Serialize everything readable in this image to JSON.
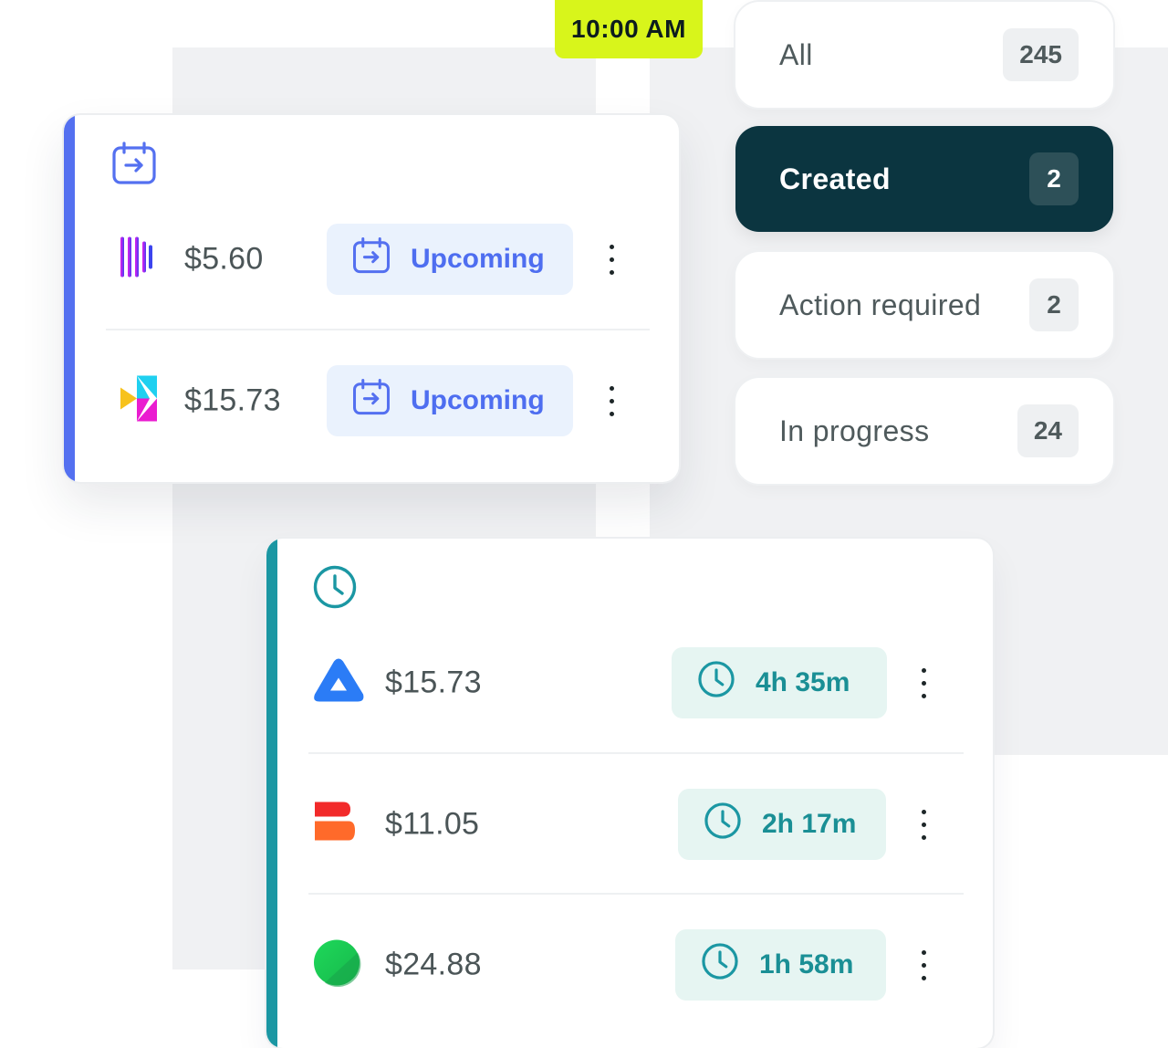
{
  "time_badge": "10:00 AM",
  "filters": [
    {
      "label": "All",
      "count": "245",
      "active": false
    },
    {
      "label": "Created",
      "count": "2",
      "active": true
    },
    {
      "label": "Action required",
      "count": "2",
      "active": false
    },
    {
      "label": "In progress",
      "count": "24",
      "active": false
    }
  ],
  "upcoming_card": {
    "header_icon": "calendar-arrow-icon",
    "rows": [
      {
        "logo": "bars-logo",
        "amount": "$5.60",
        "status": "Upcoming",
        "status_icon": "calendar-arrow-icon"
      },
      {
        "logo": "chevron-logo",
        "amount": "$15.73",
        "status": "Upcoming",
        "status_icon": "calendar-arrow-icon"
      }
    ]
  },
  "progress_card": {
    "header_icon": "clock-icon",
    "rows": [
      {
        "logo": "triangle-logo",
        "amount": "$15.73",
        "status": "4h 35m",
        "status_icon": "clock-icon"
      },
      {
        "logo": "b-blocks-logo",
        "amount": "$11.05",
        "status": "2h 17m",
        "status_icon": "clock-icon"
      },
      {
        "logo": "green-circle-logo",
        "amount": "$24.88",
        "status": "1h 58m",
        "status_icon": "clock-icon"
      }
    ]
  },
  "colors": {
    "badge": "#d8f51b",
    "active_filter": "#0b3540",
    "upcoming_accent": "#5470f0",
    "progress_accent": "#1b97a3"
  }
}
